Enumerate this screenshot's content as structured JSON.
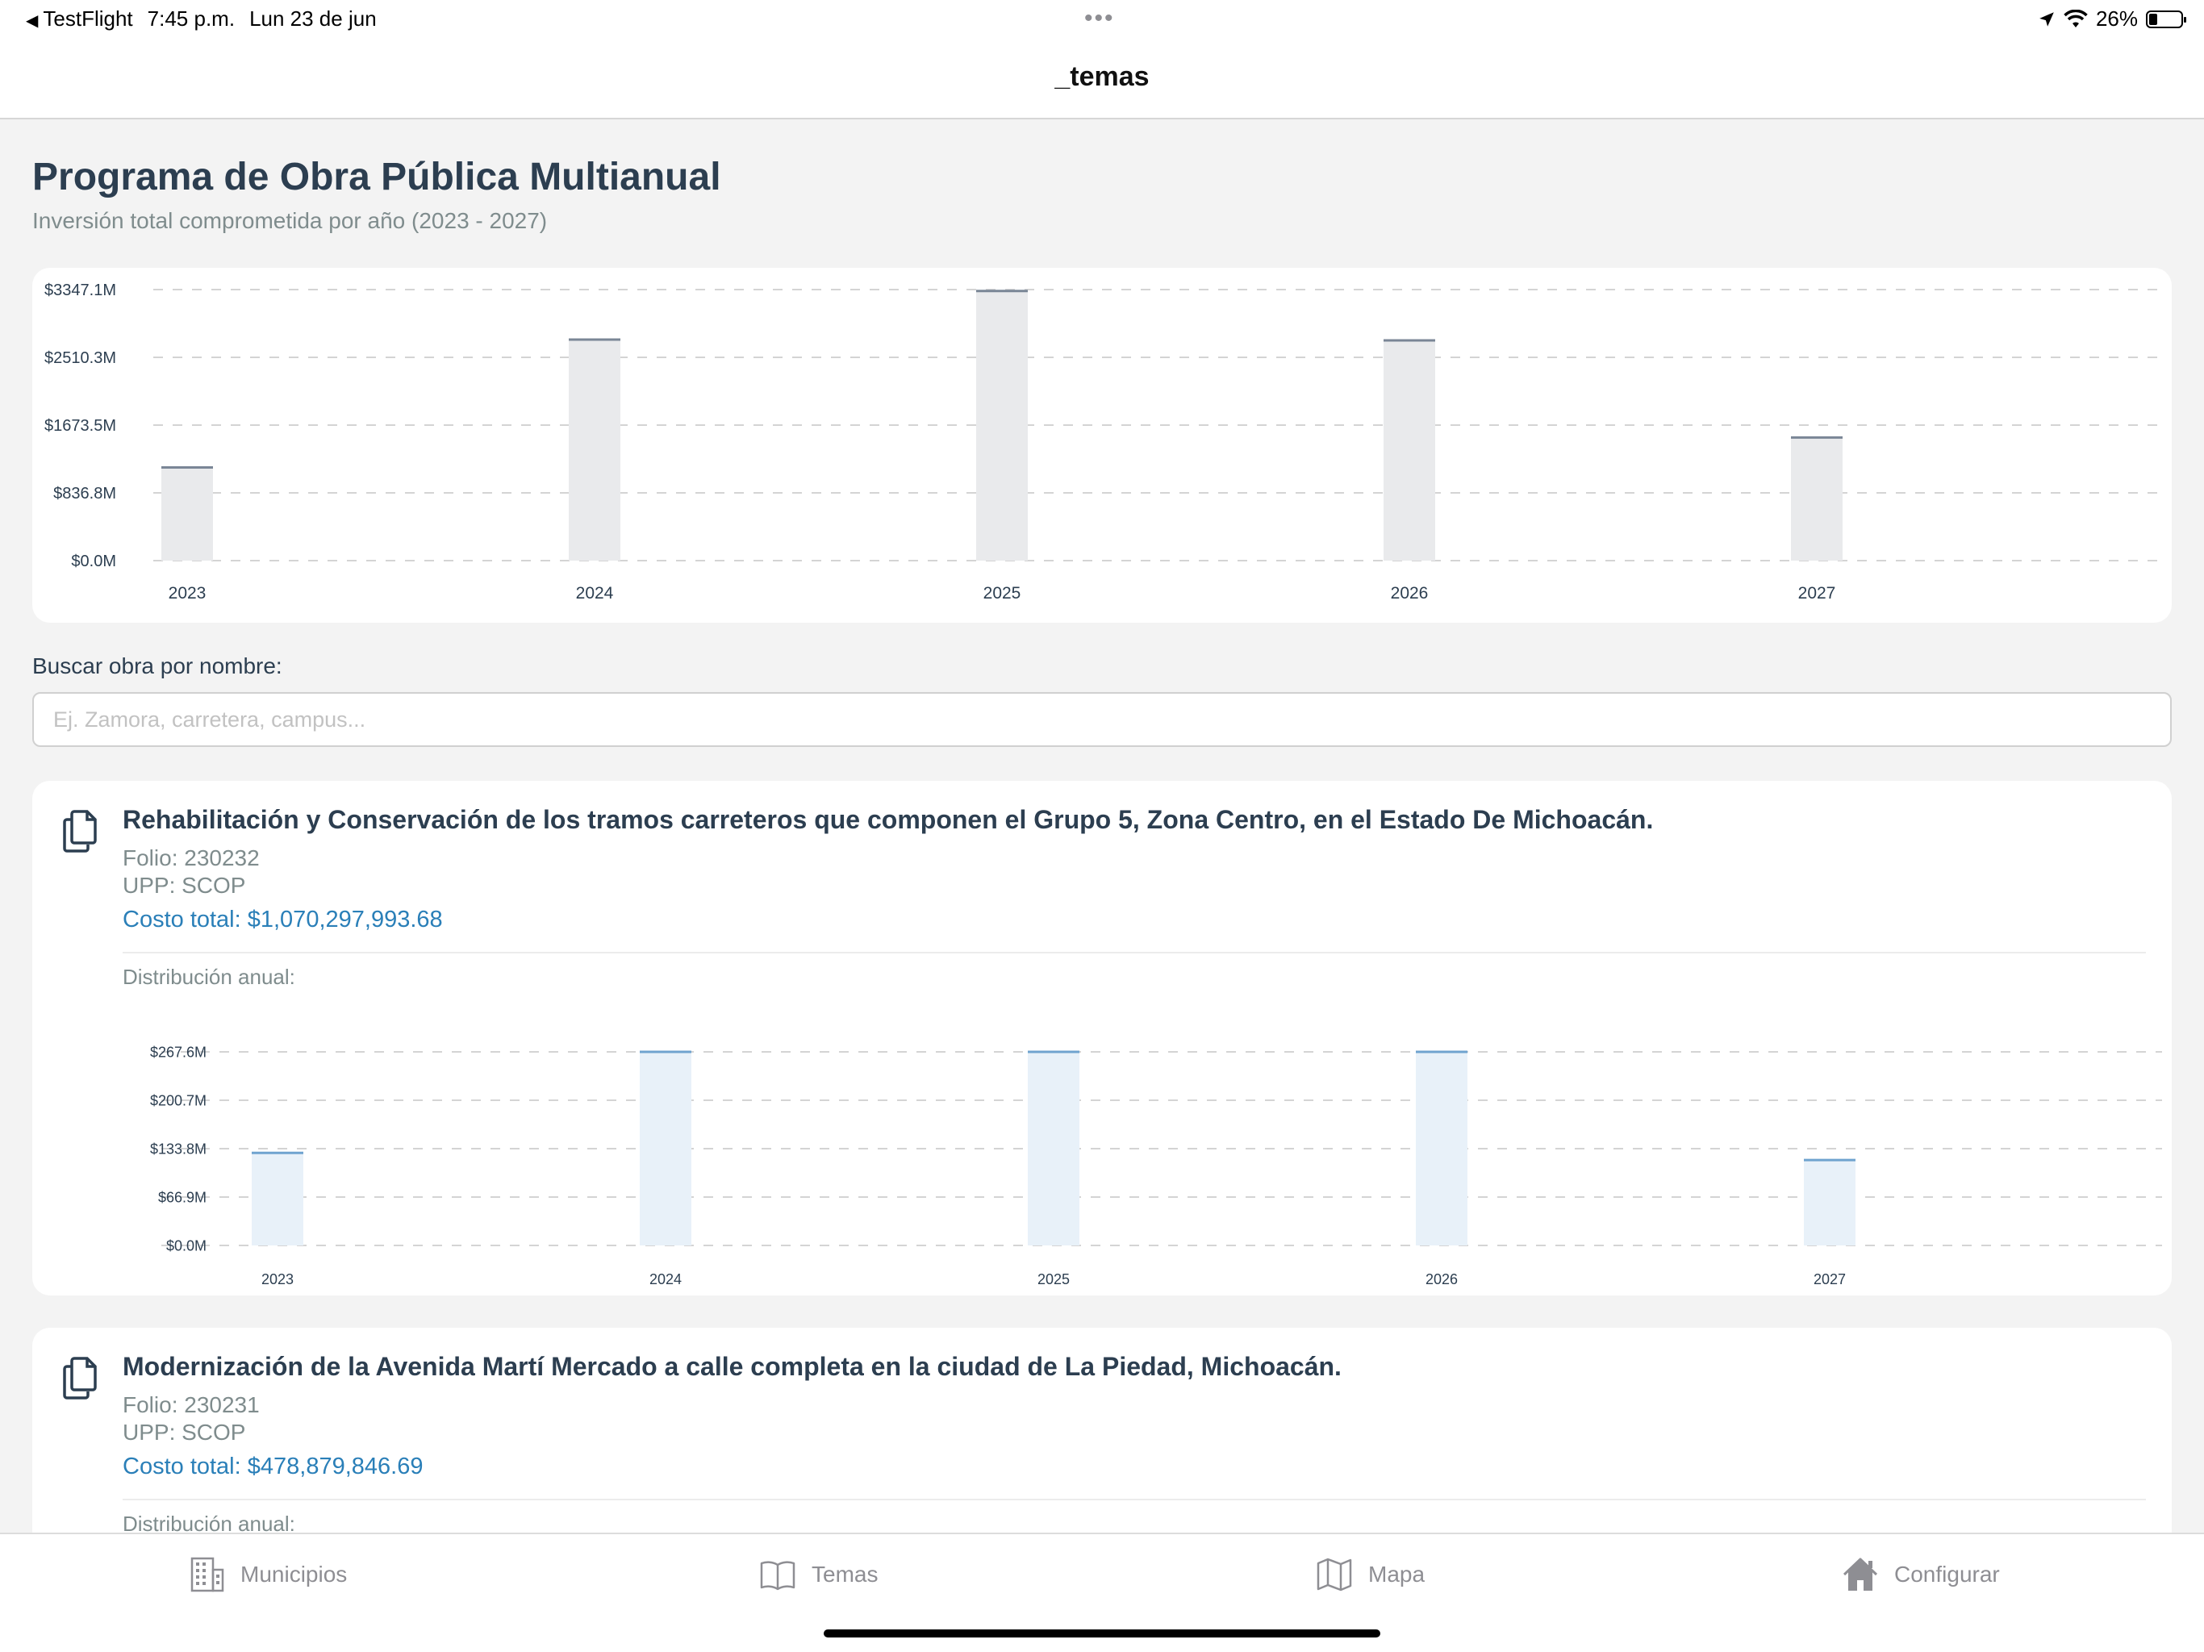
{
  "status_bar": {
    "back_app": "TestFlight",
    "time": "7:45 p.m.",
    "date": "Lun 23 de jun",
    "dots": "•••",
    "battery_label": "26%",
    "battery_level": 0.26
  },
  "nav": {
    "title": "_temas"
  },
  "header": {
    "title": "Programa de Obra Pública Multianual",
    "subtitle": "Inversión total comprometida por año (2023 - 2027)"
  },
  "chart_data": [
    {
      "type": "bar",
      "categories": [
        "2023",
        "2024",
        "2025",
        "2026",
        "2027"
      ],
      "values": [
        1150,
        2730,
        3330,
        2720,
        1520
      ],
      "ytick_labels": [
        "$0.0M",
        "$836.8M",
        "$1673.5M",
        "$2510.3M",
        "$3347.1M"
      ],
      "ylim": [
        0,
        3347.1
      ],
      "grid": true,
      "colors": {
        "fill": "#e9eaec",
        "top": "#7a8696"
      }
    },
    {
      "type": "bar",
      "categories": [
        "2023",
        "2024",
        "2025",
        "2026",
        "2027"
      ],
      "values": [
        128,
        267.6,
        267.6,
        267.6,
        118
      ],
      "ytick_labels": [
        "$0.0M",
        "$66.9M",
        "$133.8M",
        "$200.7M",
        "$267.6M"
      ],
      "ylim": [
        0,
        267.6
      ],
      "grid": true,
      "colors": {
        "fill": "#e8f1f9",
        "top": "#6fa3cf"
      }
    }
  ],
  "search": {
    "label": "Buscar obra por nombre:",
    "placeholder": "Ej. Zamora, carretera, campus...",
    "value": ""
  },
  "obras": [
    {
      "title": "Rehabilitación y Conservación de los tramos carreteros que componen el Grupo 5, Zona Centro, en el Estado De Michoacán.",
      "folio": "Folio: 230232",
      "upp": "UPP: SCOP",
      "cost": "Costo total: $1,070,297,993.68",
      "dist_label": "Distribución anual:"
    },
    {
      "title": "Modernización de la Avenida Martí Mercado a calle completa en la ciudad de La Piedad, Michoacán.",
      "folio": "Folio: 230231",
      "upp": "UPP: SCOP",
      "cost": "Costo total: $478,879,846.69",
      "dist_label": "Distribución anual:"
    }
  ],
  "tabs": [
    {
      "label": "Municipios",
      "icon": "building-icon"
    },
    {
      "label": "Temas",
      "icon": "book-icon"
    },
    {
      "label": "Mapa",
      "icon": "map-icon"
    },
    {
      "label": "Configurar",
      "icon": "house-icon"
    }
  ]
}
